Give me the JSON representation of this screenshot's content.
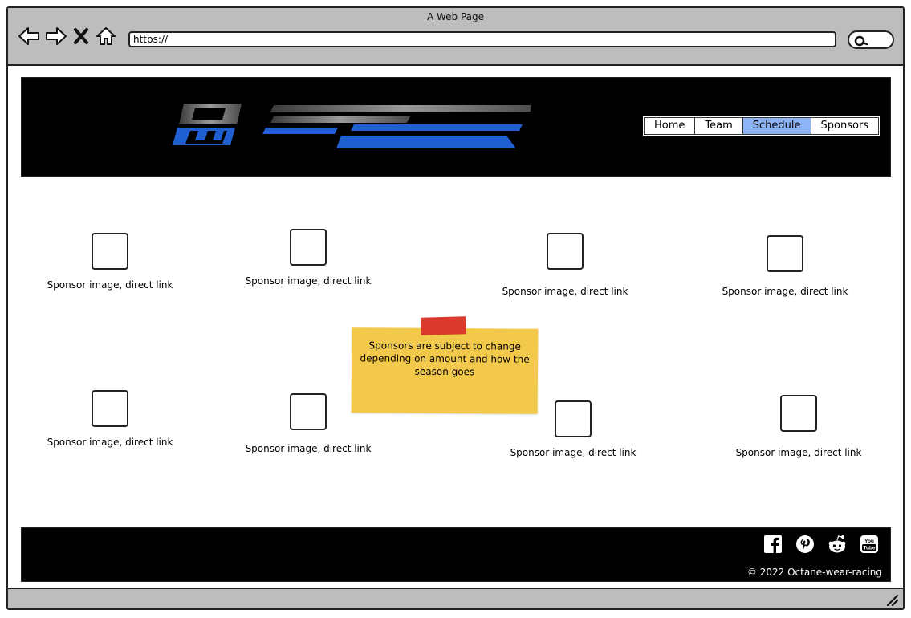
{
  "browser": {
    "window_title": "A Web Page",
    "url": "https://"
  },
  "header": {
    "logo_alt": "OCTANE WEAR",
    "nav": [
      {
        "label": "Home",
        "active": false
      },
      {
        "label": "Team",
        "active": false
      },
      {
        "label": "Schedule",
        "active": true
      },
      {
        "label": "Sponsors",
        "active": false
      }
    ]
  },
  "sponsors": [
    {
      "caption": "Sponsor image, direct link"
    },
    {
      "caption": "Sponsor image, direct link"
    },
    {
      "caption": "Sponsor image, direct link"
    },
    {
      "caption": "Sponsor image, direct link"
    },
    {
      "caption": "Sponsor image, direct link"
    },
    {
      "caption": "Sponsor image, direct link"
    },
    {
      "caption": "Sponsor image, direct link"
    },
    {
      "caption": "Sponsor image, direct link"
    }
  ],
  "note": {
    "text": "Sponsors are subject to change depending on amount and how the season goes"
  },
  "footer": {
    "socials": [
      "facebook-icon",
      "pinterest-icon",
      "reddit-icon",
      "youtube-icon"
    ],
    "copyright": "© 2022 Octane-wear-racing"
  },
  "colors": {
    "chrome": "#bdbdbd",
    "header_bg": "#000000",
    "nav_active": "#8fb4f5",
    "note": "#f3c94c",
    "tape": "#d93a2b",
    "logo_blue": "#1f5fd1"
  }
}
